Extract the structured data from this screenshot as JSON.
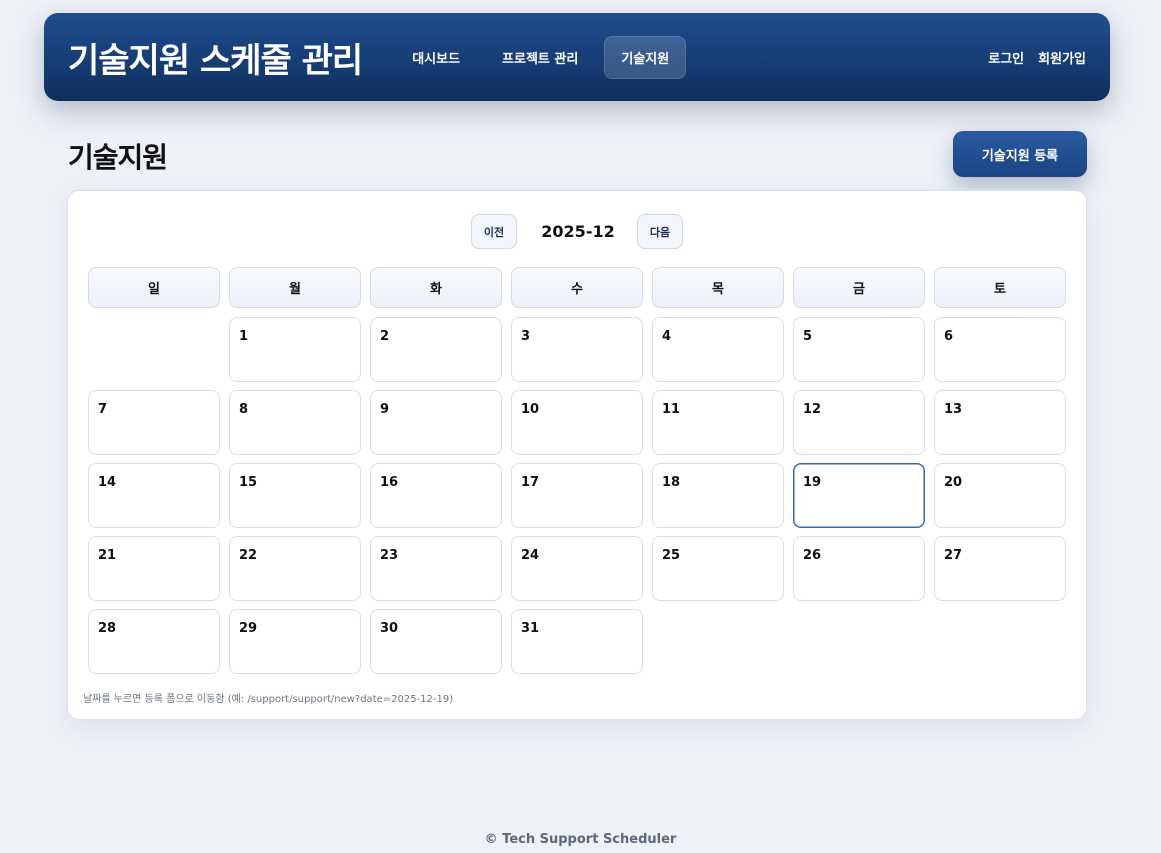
{
  "app": {
    "brand": "기술지원 스케줄 관리"
  },
  "nav": {
    "links": [
      {
        "label": "대시보드"
      },
      {
        "label": "프로젝트 관리"
      },
      {
        "label": "기술지원",
        "active": true
      }
    ],
    "login": "로그인",
    "signup": "회원가입"
  },
  "page": {
    "title": "기술지원",
    "register_label": "기술지원 등록"
  },
  "calendar": {
    "prev_label": "이전",
    "next_label": "다음",
    "month": "2025-12",
    "weekdays": [
      "일",
      "월",
      "화",
      "수",
      "목",
      "금",
      "토"
    ],
    "leading_blank_days": 1,
    "days": [
      "1",
      "2",
      "3",
      "4",
      "5",
      "6",
      "7",
      "8",
      "9",
      "10",
      "11",
      "12",
      "13",
      "14",
      "15",
      "16",
      "17",
      "18",
      "19",
      "20",
      "21",
      "22",
      "23",
      "24",
      "25",
      "26",
      "27",
      "28",
      "29",
      "30",
      "31"
    ],
    "today": "19",
    "hint": "날짜를 누르면 등록 폼으로 이동함 (예: /support/support/new?date=2025-12-19)"
  },
  "footer": {
    "text": "© Tech Support Scheduler"
  },
  "colors": {
    "brand_dark": "#163d75",
    "accent": "#2f66b8",
    "background": "#eef1f6"
  }
}
